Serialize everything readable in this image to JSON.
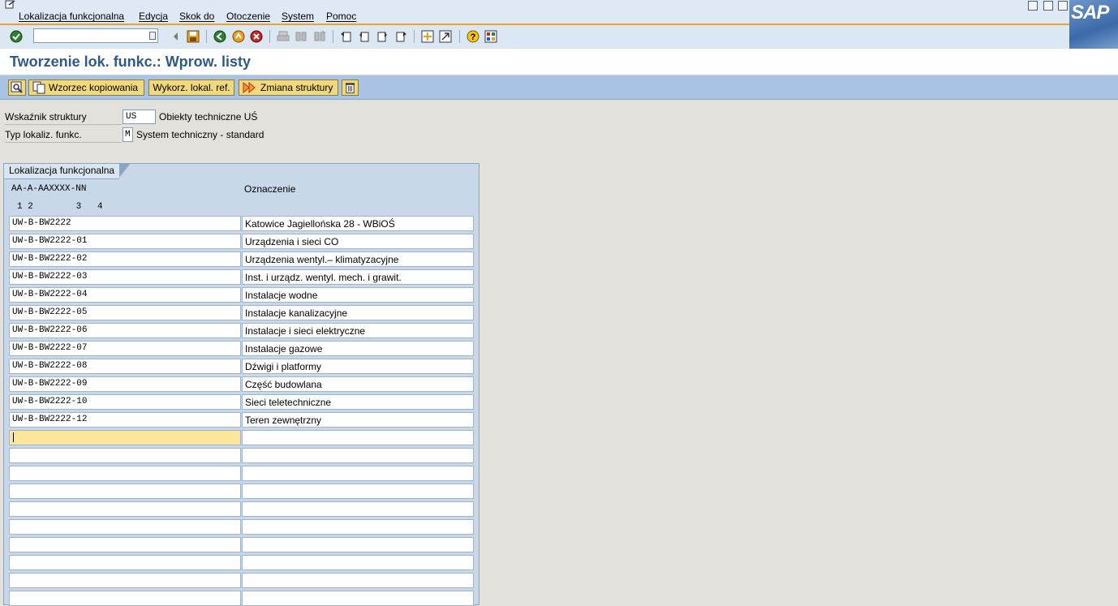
{
  "menu": {
    "items": [
      "Lokalizacja funkcjonalna",
      "Edycja",
      "Skok do",
      "Otoczenie",
      "System",
      "Pomoc"
    ]
  },
  "logo_text": "SAP",
  "toolbar": {
    "command_value": "",
    "icons": [
      "enter-icon",
      "back-icon",
      "save-icon",
      "back-green-icon",
      "exit-icon",
      "cancel-icon",
      "print-icon",
      "find-icon",
      "find-next-icon",
      "first-page-icon",
      "previous-page-icon",
      "next-page-icon",
      "last-page-icon",
      "create-session-icon",
      "shortcut-icon",
      "help-icon",
      "layout-icon"
    ]
  },
  "title": "Tworzenie lok. funkc.: Wprow. listy",
  "app_toolbar": {
    "copy_template": "Wzorzec kopiowania",
    "use_ref": "Wykorz. lokal. ref.",
    "change_structure": "Zmiana struktury"
  },
  "header": {
    "structure_label": "Wskaźnik struktury",
    "structure_value": "US",
    "structure_text": "Obiekty techniczne UŚ",
    "type_label": "Typ lokaliz. funkc.",
    "type_value": "M",
    "type_text": "System techniczny - standard"
  },
  "table": {
    "tab_label": "Lokalizacja funkcjonalna",
    "mask": "AA-A-AAXXXX-NN",
    "levels": "1 2        3   4",
    "desc_header": "Oznaczenie",
    "rows": [
      {
        "code": "UW-B-BW2222",
        "desc": "Katowice Jagiellońska 28 - WBiOŚ"
      },
      {
        "code": "UW-B-BW2222-01",
        "desc": "Urządzenia i sieci CO"
      },
      {
        "code": "UW-B-BW2222-02",
        "desc": "Urządzenia wentyl.– klimatyzacyjne"
      },
      {
        "code": "UW-B-BW2222-03",
        "desc": "Inst. i urządz. wentyl. mech. i grawit."
      },
      {
        "code": "UW-B-BW2222-04",
        "desc": "Instalacje wodne"
      },
      {
        "code": "UW-B-BW2222-05",
        "desc": "Instalacje kanalizacyjne"
      },
      {
        "code": "UW-B-BW2222-06",
        "desc": "Instalacje i sieci elektryczne"
      },
      {
        "code": "UW-B-BW2222-07",
        "desc": "Instalacje gazowe"
      },
      {
        "code": "UW-B-BW2222-08",
        "desc": "Dźwigi i platformy"
      },
      {
        "code": "UW-B-BW2222-09",
        "desc": "Część budowlana"
      },
      {
        "code": "UW-B-BW2222-10",
        "desc": "Sieci teletechniczne"
      },
      {
        "code": "UW-B-BW2222-12",
        "desc": "Teren zewnętrzny"
      },
      {
        "code": "",
        "desc": ""
      },
      {
        "code": "",
        "desc": ""
      },
      {
        "code": "",
        "desc": ""
      },
      {
        "code": "",
        "desc": ""
      },
      {
        "code": "",
        "desc": ""
      },
      {
        "code": "",
        "desc": ""
      },
      {
        "code": "",
        "desc": ""
      },
      {
        "code": "",
        "desc": ""
      },
      {
        "code": "",
        "desc": ""
      },
      {
        "code": "",
        "desc": ""
      }
    ]
  },
  "colors": {
    "menubar_bg": "#dfe9f5",
    "accent_line": "#f0a030",
    "app_toolbar_bg": "#a9c4e2",
    "button_bg": "#f0d87c",
    "title_color": "#2e5a8a",
    "active_cell": "#fbe69a"
  }
}
